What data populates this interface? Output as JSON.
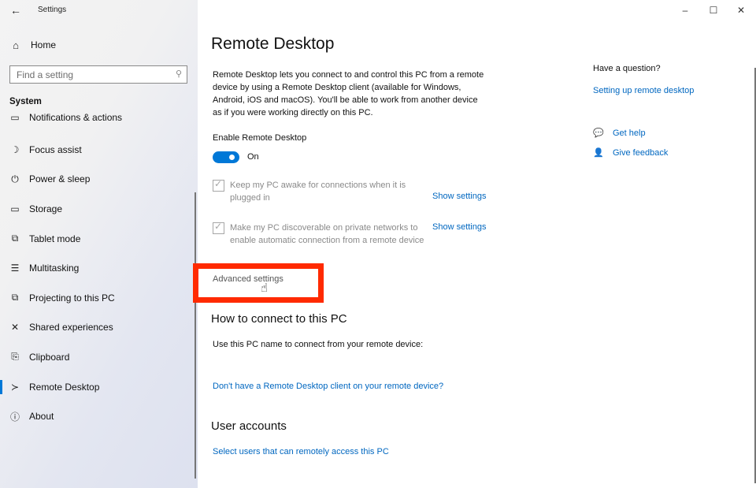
{
  "window": {
    "app_title": "Settings",
    "back_icon": "arrow-left-icon",
    "controls": {
      "minimize": "–",
      "maximize": "☐",
      "close": "✕"
    }
  },
  "sidebar": {
    "home": {
      "label": "Home",
      "icon": "⌂"
    },
    "search": {
      "placeholder": "Find a setting",
      "icon": "⚲"
    },
    "section_title": "System",
    "items": [
      {
        "label": "Notifications & actions",
        "icon": "▭",
        "partial": true
      },
      {
        "label": "Focus assist",
        "icon": "☽"
      },
      {
        "label": "Power & sleep",
        "icon": "⏻"
      },
      {
        "label": "Storage",
        "icon": "▭"
      },
      {
        "label": "Tablet mode",
        "icon": "⧉"
      },
      {
        "label": "Multitasking",
        "icon": "☰"
      },
      {
        "label": "Projecting to this PC",
        "icon": "⧉"
      },
      {
        "label": "Shared experiences",
        "icon": "✕"
      },
      {
        "label": "Clipboard",
        "icon": "⎘"
      },
      {
        "label": "Remote Desktop",
        "icon": "≻",
        "active": true
      },
      {
        "label": "About",
        "icon": "ⓘ"
      }
    ]
  },
  "main": {
    "title": "Remote Desktop",
    "description": "Remote Desktop lets you connect to and control this PC from a remote device by using a Remote Desktop client (available for Windows, Android, iOS and macOS). You'll be able to work from another device as if you were working directly on this PC.",
    "enable_label": "Enable Remote Desktop",
    "toggle": {
      "on": true,
      "state_label": "On"
    },
    "options": [
      {
        "label": "Keep my PC awake for connections when it is plugged in",
        "checked": true,
        "action": "Show settings"
      },
      {
        "label": "Make my PC discoverable on private networks to enable automatic connection from a remote device",
        "checked": true,
        "action": "Show settings"
      }
    ],
    "advanced_settings": "Advanced settings",
    "how_to_connect": {
      "heading": "How to connect to this PC",
      "text": "Use this PC name to connect from your remote device:",
      "link": "Don't have a Remote Desktop client on your remote device?"
    },
    "user_accounts": {
      "heading": "User accounts",
      "link": "Select users that can remotely access this PC"
    }
  },
  "help_panel": {
    "question": "Have a question?",
    "link": "Setting up remote desktop",
    "get_help": "Get help",
    "give_feedback": "Give feedback"
  },
  "colors": {
    "accent": "#0078d7",
    "link": "#0067c0",
    "highlight": "#ff2a00"
  }
}
